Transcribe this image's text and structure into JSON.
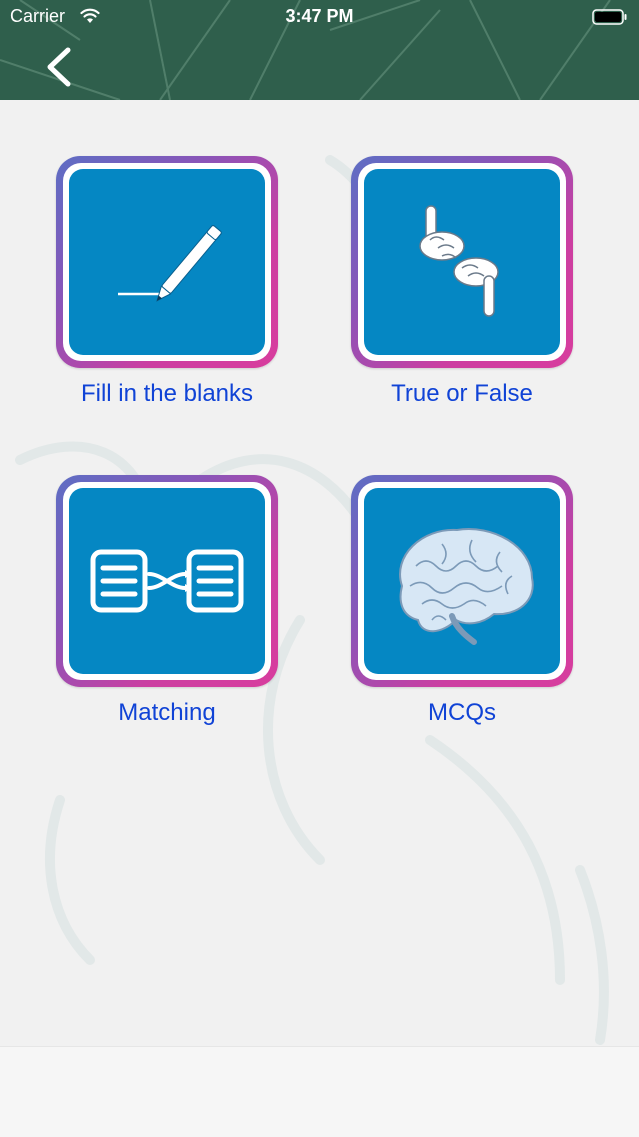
{
  "status_bar": {
    "carrier": "Carrier",
    "time": "3:47 PM",
    "wifi_icon": "wifi-icon",
    "battery_icon": "battery-icon"
  },
  "header": {
    "back_icon": "chevron-left-icon",
    "color": "#2f5f4c"
  },
  "tiles": [
    {
      "label": "Fill in the blanks",
      "icon": "pencil-line-icon"
    },
    {
      "label": "True or False",
      "icon": "pointing-hands-icon"
    },
    {
      "label": "Matching",
      "icon": "matching-lists-icon"
    },
    {
      "label": "MCQs",
      "icon": "brain-icon"
    }
  ],
  "colors": {
    "tile_blue": "#0587c3",
    "label_blue": "#1043d6",
    "frame_gradient_start": "#5d6ec4",
    "frame_gradient_end": "#d83d9e"
  }
}
